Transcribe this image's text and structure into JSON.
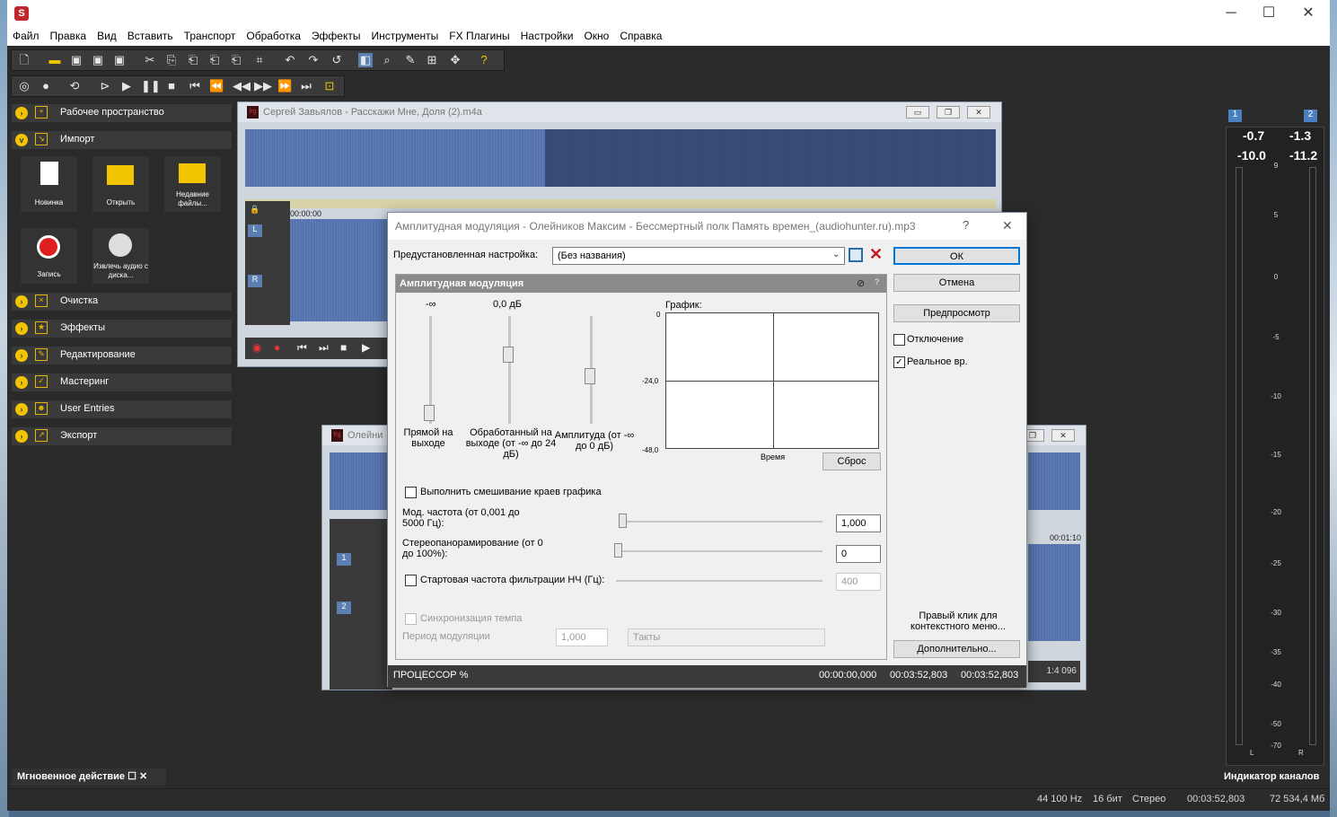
{
  "menu": [
    "Файл",
    "Правка",
    "Вид",
    "Вставить",
    "Транспорт",
    "Обработка",
    "Эффекты",
    "Инструменты",
    "FX Плагины",
    "Настройки",
    "Окно",
    "Справка"
  ],
  "sidebar": {
    "sections": [
      "Рабочее пространство",
      "Импорт",
      "Очистка",
      "Эффекты",
      "Редактирование",
      "Мастеринг",
      "User Entries",
      "Экспорт"
    ],
    "tiles": [
      "Новинка",
      "Открыть",
      "Недавние файлы...",
      "Запись",
      "Извлечь аудио с диска..."
    ],
    "quick_action": "Мгновенное действие"
  },
  "win1": {
    "title": "Сергей Завьялов - Расскажи Мне, Доля (2).m4a",
    "time_start": "00:00:00",
    "ch_l": "L",
    "ch_r": "R"
  },
  "win2": {
    "title": "Олейни",
    "ch1": "1",
    "ch2": "2",
    "zoom": "1:4 096",
    "time": "00:01:10"
  },
  "dialog": {
    "title": "Амплитудная модуляция - Олейников Максим - Бессмертный полк Память времен_(audiohunter.ru).mp3",
    "help": "?",
    "close": "✕",
    "preset_label": "Предустановленная настройка:",
    "preset_value": "(Без названия)",
    "section_title": "Амплитудная модуляция",
    "slider1_value": "-∞",
    "slider2_value": "0,0 дБ",
    "slider1_label": "Прямой на выходе",
    "slider2_label": "Обработанный на выходе (от -∞ до 24 дБ)",
    "slider3_label": "Амплитуда (от -∞ до 0 дБ)",
    "graph_label": "График:",
    "graph_y": [
      "0",
      "-24,0",
      "-48,0"
    ],
    "graph_x": "Время",
    "reset": "Сброс",
    "smooth": "Выполнить смешивание краев графика",
    "mod_freq_label": "Мод. частота (от 0,001 до 5000 Гц):",
    "mod_freq_value": "1,000",
    "stereo_label": "Стереопанорамирование (от 0 до 100%):",
    "stereo_value": "0",
    "lpf_label": "Стартовая частота фильтрации НЧ (Гц):",
    "lpf_value": "400",
    "tempo_sync": "Синхронизация темпа",
    "mod_period": "Период модуляции",
    "mod_period_value": "1,000",
    "mod_period_unit": "Такты",
    "ok": "ОК",
    "cancel": "Отмена",
    "preview": "Предпросмотр",
    "bypass": "Отключение",
    "realtime": "Реальное вр.",
    "hint": "Правый клик для контекстного меню...",
    "more": "Дополнительно...",
    "cpu": "ПРОЦЕССОР %",
    "t1": "00:00:00,000",
    "t2": "00:03:52,803",
    "t3": "00:03:52,803"
  },
  "meter": {
    "ch1": "1",
    "ch2": "2",
    "peak_l": "-0.7",
    "peak_r": "-1.3",
    "rms_l": "-10.0",
    "rms_r": "-11.2",
    "scale": [
      "9",
      "5",
      "0",
      "-5",
      "-10",
      "-15",
      "-20",
      "-25",
      "-30",
      "-35",
      "-40",
      "-50",
      "-70"
    ],
    "L": "L",
    "R": "R",
    "title": "Индикатор каналов"
  },
  "status": {
    "rate": "44 100 Hz",
    "bits": "16 бит",
    "mode": "Стерео",
    "dur": "00:03:52,803",
    "size": "72 534,4 Мб"
  }
}
